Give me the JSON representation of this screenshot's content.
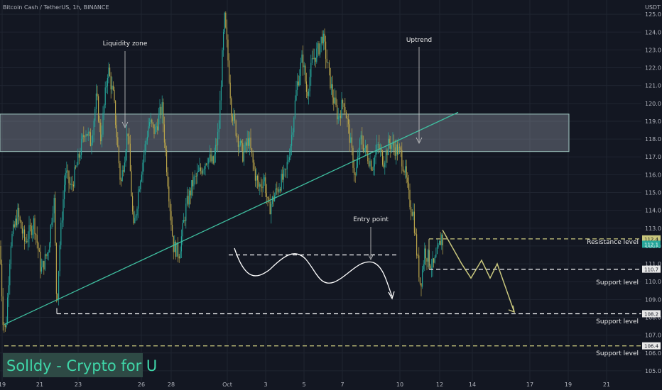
{
  "header": {
    "symbol_title": "Bitcoin Cash / TetherUS, 1h, BINANCE",
    "currency": "USDT"
  },
  "brand": "Solldy - Crypto for U",
  "colors": {
    "background": "#131722",
    "candle_up": "#26a69a",
    "candle_down": "#b9a44a",
    "trendline": "#3fbfa0",
    "zone_fill": "rgba(170,175,190,0.33)",
    "zone_border": "#9fc7c0",
    "resistance": "#c9c77d",
    "support": "#ffffff",
    "projection": "#c9c77d",
    "brand_bg": "#2e4a45",
    "brand_text": "#3fd6a8",
    "current_price_bg": "#26a69a"
  },
  "annotations": {
    "liquidity_zone": "Liquidity zone",
    "uptrend": "Uptrend",
    "entry_point": "Entry point"
  },
  "levels": {
    "resistance_label": "Resistance level",
    "support_label_1": "Support level",
    "support_label_2": "Support level",
    "support_label_3": "Support level"
  },
  "chart_data": {
    "type": "candlestick",
    "title": "Bitcoin Cash / TetherUS, 1h, BINANCE",
    "y_axis_unit": "USDT",
    "ylim": [
      104.4,
      125.8
    ],
    "y_ticks": [
      "105.0",
      "106.0",
      "107.0",
      "108.0",
      "109.0",
      "110.0",
      "111.0",
      "112.0",
      "113.0",
      "114.0",
      "115.0",
      "116.0",
      "117.0",
      "118.0",
      "119.0",
      "120.0",
      "121.0",
      "122.0",
      "123.0",
      "124.0",
      "125.0"
    ],
    "x_ticks": [
      "19",
      "21",
      "23",
      "26",
      "28",
      "Oct",
      "3",
      "5",
      "7",
      "10",
      "12",
      "14",
      "17",
      "19",
      "21"
    ],
    "price_path": [
      [
        0,
        112.0
      ],
      [
        4,
        108.0
      ],
      [
        8,
        107.2
      ],
      [
        15,
        112.2
      ],
      [
        25,
        113.8
      ],
      [
        35,
        112.2
      ],
      [
        48,
        113.4
      ],
      [
        58,
        110.6
      ],
      [
        68,
        111.8
      ],
      [
        76,
        114.8
      ],
      [
        80,
        108.5
      ],
      [
        84,
        112.0
      ],
      [
        92,
        116.2
      ],
      [
        100,
        115.2
      ],
      [
        110,
        116.8
      ],
      [
        120,
        118.6
      ],
      [
        128,
        117.8
      ],
      [
        136,
        120.4
      ],
      [
        142,
        118.0
      ],
      [
        152,
        122.0
      ],
      [
        160,
        120.3
      ],
      [
        170,
        115.4
      ],
      [
        180,
        118.6
      ],
      [
        188,
        112.8
      ],
      [
        196,
        115.5
      ],
      [
        210,
        119.0
      ],
      [
        218,
        118.4
      ],
      [
        228,
        119.8
      ],
      [
        236,
        115.8
      ],
      [
        244,
        112.0
      ],
      [
        252,
        111.6
      ],
      [
        262,
        114.2
      ],
      [
        272,
        115.6
      ],
      [
        282,
        116.2
      ],
      [
        292,
        117.0
      ],
      [
        300,
        116.6
      ],
      [
        308,
        118.5
      ],
      [
        312,
        121.8
      ],
      [
        316,
        124.8
      ],
      [
        320,
        123.0
      ],
      [
        326,
        119.6
      ],
      [
        334,
        118.2
      ],
      [
        342,
        117.1
      ],
      [
        350,
        118.0
      ],
      [
        358,
        116.2
      ],
      [
        364,
        115.3
      ],
      [
        372,
        115.8
      ],
      [
        378,
        114.0
      ],
      [
        386,
        114.8
      ],
      [
        394,
        115.5
      ],
      [
        402,
        116.0
      ],
      [
        410,
        118.0
      ],
      [
        418,
        121.0
      ],
      [
        426,
        122.6
      ],
      [
        432,
        120.5
      ],
      [
        440,
        122.4
      ],
      [
        448,
        123.0
      ],
      [
        454,
        123.8
      ],
      [
        460,
        122.4
      ],
      [
        468,
        120.5
      ],
      [
        476,
        119.2
      ],
      [
        484,
        120.2
      ],
      [
        492,
        118.2
      ],
      [
        500,
        115.8
      ],
      [
        508,
        118.0
      ],
      [
        516,
        117.2
      ],
      [
        524,
        116.5
      ],
      [
        532,
        117.6
      ],
      [
        540,
        116.8
      ],
      [
        548,
        117.8
      ],
      [
        556,
        117.5
      ],
      [
        564,
        117.2
      ],
      [
        570,
        116.2
      ],
      [
        576,
        114.6
      ],
      [
        582,
        113.8
      ],
      [
        587,
        111.5
      ],
      [
        592,
        109.8
      ],
      [
        598,
        111.8
      ],
      [
        604,
        111.2
      ],
      [
        610,
        110.8
      ],
      [
        616,
        111.6
      ],
      [
        622,
        112.6
      ],
      [
        624,
        112.1
      ]
    ],
    "current_price": "112.1",
    "price_tags": [
      "112.4",
      "110.7",
      "108.2",
      "106.4"
    ],
    "liquidity_zone_range": [
      117.3,
      119.4
    ],
    "trendline": {
      "from_price": 107.6,
      "to_price": 119.5
    },
    "resistance_level": 112.4,
    "support_levels": [
      110.7,
      108.2,
      106.4
    ],
    "entry_line_level": 111.5,
    "projection_path": [
      112.9,
      111.0,
      110.2,
      111.2,
      110.2,
      111.0,
      108.3
    ]
  }
}
